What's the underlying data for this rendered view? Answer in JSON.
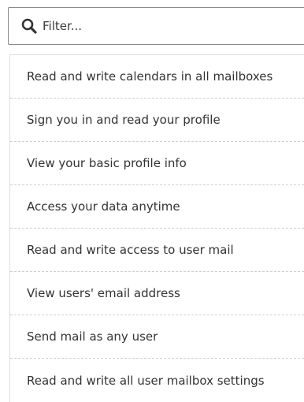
{
  "filter": {
    "placeholder": "Filter...",
    "value": ""
  },
  "permissions": [
    {
      "label": "Read and write calendars in all mailboxes"
    },
    {
      "label": "Sign you in and read your profile"
    },
    {
      "label": "View your basic profile info"
    },
    {
      "label": "Access your data anytime"
    },
    {
      "label": "Read and write access to user mail"
    },
    {
      "label": "View users' email address"
    },
    {
      "label": "Send mail as any user"
    },
    {
      "label": "Read and write all user mailbox settings"
    }
  ],
  "icons": {
    "search": "search-icon"
  },
  "colors": {
    "text": "#333333",
    "border": "#8a8a8a",
    "divider": "#cfcfcf"
  }
}
